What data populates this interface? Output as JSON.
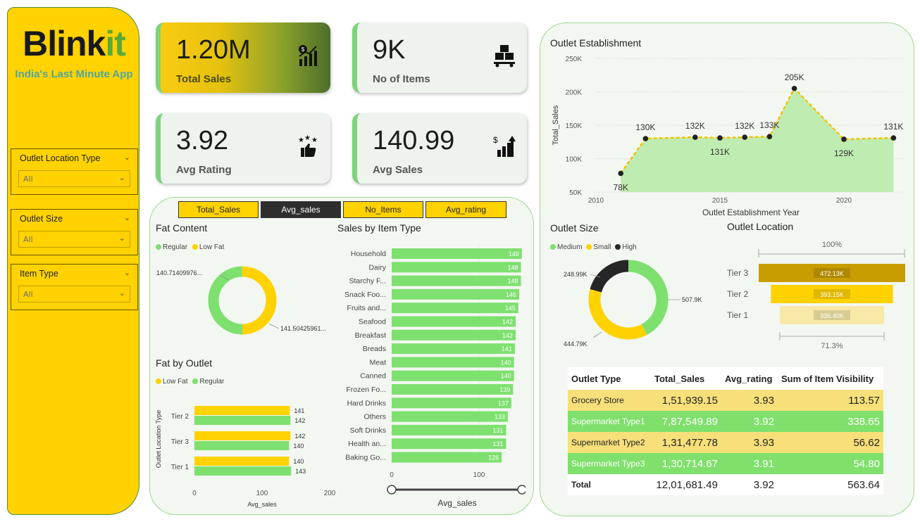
{
  "brand": {
    "name_main": "Blink",
    "name_accent": "it",
    "tagline": "India's Last Minute App"
  },
  "slicers": [
    {
      "title": "Outlet Location Type",
      "value": "All"
    },
    {
      "title": "Outlet Size",
      "value": "All"
    },
    {
      "title": "Item Type",
      "value": "All"
    }
  ],
  "kpis": {
    "total_sales": {
      "value": "1.20M",
      "label": "Total Sales"
    },
    "no_items": {
      "value": "9K",
      "label": "No of Items"
    },
    "avg_rating": {
      "value": "3.92",
      "label": "Avg Rating"
    },
    "avg_sales": {
      "value": "140.99",
      "label": "Avg Sales"
    }
  },
  "tabs": [
    "Total_Sales",
    "Avg_sales",
    "No_Items",
    "Avg_rating"
  ],
  "active_tab": "Avg_sales",
  "colors": {
    "green": "#7ee06f",
    "yellow": "#ffd200",
    "dark": "#262626",
    "tier3": "#c79d00",
    "tier2": "#ffd200",
    "tier1": "#f8e9a8"
  },
  "chart_data": [
    {
      "id": "fat_content",
      "type": "pie",
      "title": "Fat Content",
      "legend": [
        "Regular",
        "Low Fat"
      ],
      "labels": [
        "Regular",
        "Low Fat"
      ],
      "values": [
        140.71409976,
        141.50425961
      ],
      "value_labels": [
        "140.71409976...",
        "141.50425961..."
      ]
    },
    {
      "id": "fat_by_outlet",
      "type": "bar",
      "title": "Fat by Outlet",
      "legend": [
        "Low Fat",
        "Regular"
      ],
      "ylabel": "Outlet Location Type",
      "xlabel": "Avg_sales",
      "categories": [
        "Tier 2",
        "Tier 3",
        "Tier 1"
      ],
      "series": [
        {
          "name": "Low Fat",
          "values": [
            141,
            142,
            140
          ]
        },
        {
          "name": "Regular",
          "values": [
            142,
            140,
            143
          ]
        }
      ],
      "xlim": [
        0,
        200
      ],
      "xticks": [
        "0",
        "100",
        "200"
      ]
    },
    {
      "id": "sales_by_item_type",
      "type": "bar",
      "title": "Sales by Item Type",
      "xlabel": "Avg_sales",
      "categories": [
        "Household",
        "Dairy",
        "Starchy F...",
        "Snack Foo...",
        "Fruits and...",
        "Seafood",
        "Breakfast",
        "Breads",
        "Meat",
        "Canned",
        "Frozen Fo...",
        "Hard Drinks",
        "Others",
        "Soft Drinks",
        "Health an...",
        "Baking Go..."
      ],
      "values": [
        149,
        148,
        148,
        146,
        145,
        142,
        142,
        141,
        140,
        140,
        139,
        137,
        133,
        131,
        131,
        126
      ],
      "xlim": [
        0,
        150
      ],
      "xticks": [
        "0",
        "100"
      ]
    },
    {
      "id": "outlet_establishment",
      "type": "area",
      "title": "Outlet Establishment",
      "xlabel": "Outlet Establishment Year",
      "ylabel": "Total_Sales",
      "x": [
        2011,
        2012,
        2014,
        2015,
        2016,
        2017,
        2018,
        2020,
        2022
      ],
      "y": [
        78,
        130,
        132,
        131,
        132,
        133,
        205,
        129,
        131
      ],
      "value_labels": [
        "78K",
        "130K",
        "132K",
        "131K",
        "132K",
        "133K",
        "205K",
        "129K",
        "131K"
      ],
      "xlim": [
        2010,
        2022.5
      ],
      "ylim": [
        50,
        250
      ],
      "xticks": [
        "2010",
        "2015",
        "2020"
      ],
      "yticks": [
        "50K",
        "100K",
        "150K",
        "200K",
        "250K"
      ]
    },
    {
      "id": "outlet_size",
      "type": "pie",
      "title": "Outlet Size",
      "legend": [
        "Medium",
        "Small",
        "High"
      ],
      "labels": [
        "Medium",
        "Small",
        "High"
      ],
      "values": [
        507.9,
        444.79,
        248.99
      ],
      "value_labels": [
        "507.9K",
        "444.79K",
        "248.99K"
      ]
    },
    {
      "id": "outlet_location",
      "type": "bar",
      "title": "Outlet Location",
      "categories": [
        "Tier 3",
        "Tier 2",
        "Tier 1"
      ],
      "values": [
        472.13,
        393.15,
        336.4
      ],
      "value_labels": [
        "472.13K",
        "393.15K",
        "336.40K"
      ],
      "top_label": "100%",
      "bottom_label": "71.3%"
    },
    {
      "id": "outlet_table",
      "type": "table",
      "columns": [
        "Outlet Type",
        "Total_Sales",
        "Avg_rating",
        "Sum of Item Visibility"
      ],
      "rows": [
        [
          "Grocery Store",
          "1,51,939.15",
          "3.93",
          "113.57"
        ],
        [
          "Supermarket Type1",
          "7,87,549.89",
          "3.92",
          "338.65"
        ],
        [
          "Supermarket Type2",
          "1,31,477.78",
          "3.93",
          "56.62"
        ],
        [
          "Supermarket Type3",
          "1,30,714.67",
          "3.91",
          "54.80"
        ]
      ],
      "total": [
        "Total",
        "12,01,681.49",
        "3.92",
        "563.64"
      ]
    }
  ]
}
